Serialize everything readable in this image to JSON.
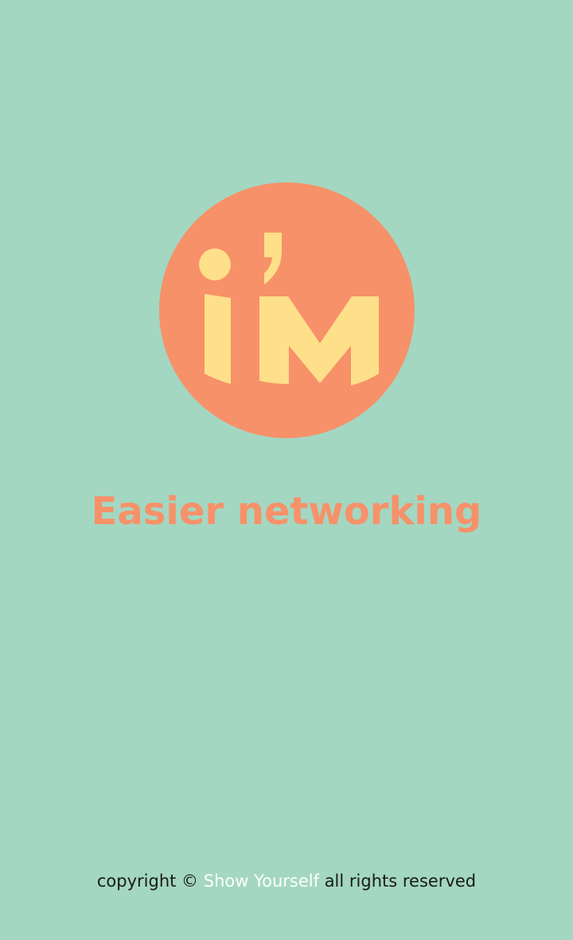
{
  "colors": {
    "background": "#a3d7c2",
    "logo_circle": "#f79169",
    "logo_letters": "#ffe08a",
    "tagline": "#f79169",
    "footer_text": "#1a1a1a",
    "footer_brand": "#ffffff"
  },
  "logo": {
    "icon": "im-logo-icon"
  },
  "tagline": "Easier networking",
  "footer": {
    "prefix": "copyright ©",
    "brand": "Show Yourself",
    "suffix": "all rights reserved"
  }
}
